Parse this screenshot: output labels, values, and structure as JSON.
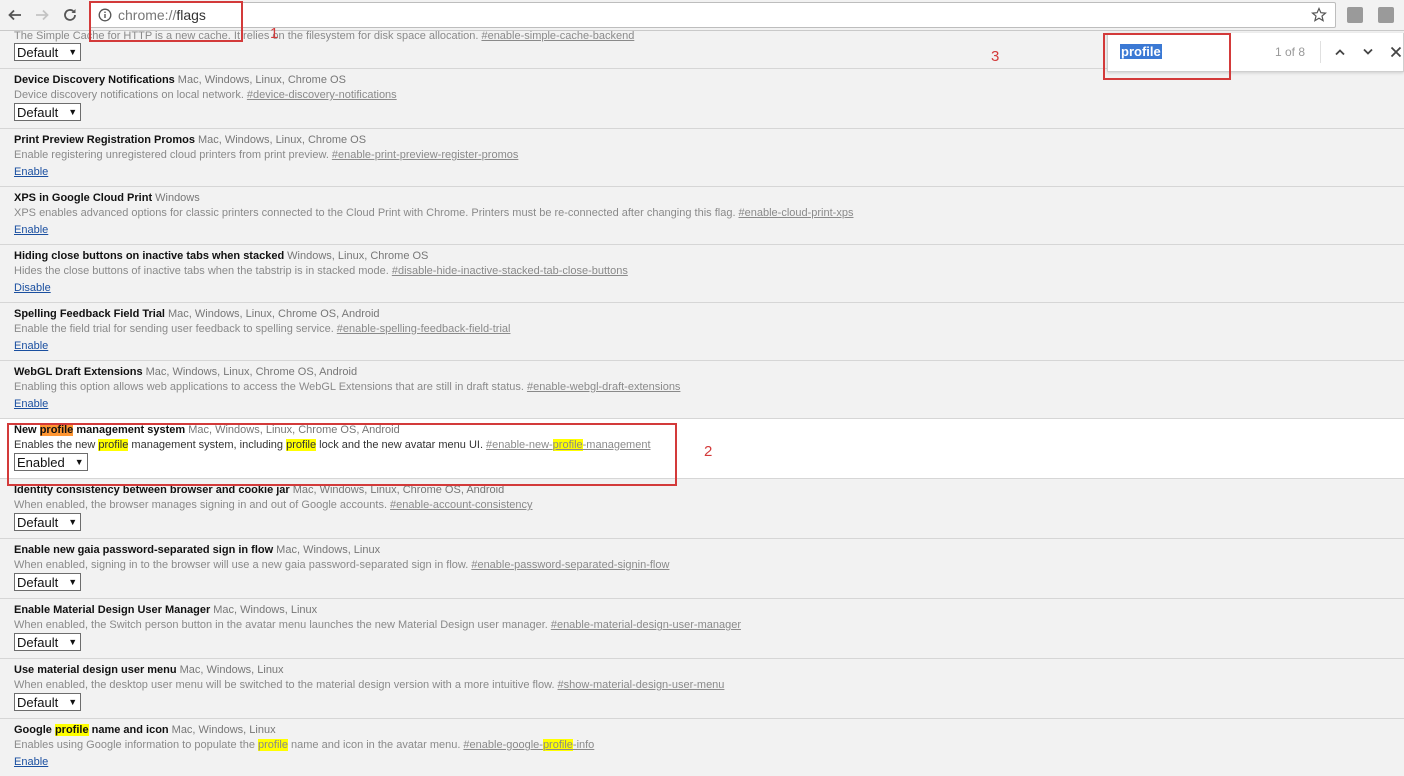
{
  "toolbar": {
    "url_scheme": "chrome://",
    "url_path": "flags",
    "icons": [
      "back-icon",
      "forward-icon",
      "reload-icon",
      "info-icon",
      "star-icon",
      "extension-icon"
    ]
  },
  "find": {
    "query": "profile",
    "count": "1 of 8",
    "icons": [
      "chevron-up-icon",
      "chevron-down-icon",
      "close-icon"
    ]
  },
  "annotations": {
    "n1": "1",
    "n2": "2",
    "n3": "3"
  },
  "colors": {
    "highlight": "#ffff00",
    "active_highlight": "#ff9632",
    "annotation": "#d33a3a",
    "link": "#1a4fa0"
  },
  "rows": [
    {
      "desc": "The Simple Cache for HTTP is a new cache. It relies on the filesystem for disk space allocation.",
      "anchor": "#enable-simple-cache-backend",
      "control": "Default"
    },
    {
      "title": "Device Discovery Notifications",
      "platforms": "Mac, Windows, Linux, Chrome OS",
      "desc": "Device discovery notifications on local network.",
      "anchor": "#device-discovery-notifications",
      "control": "Default"
    },
    {
      "title": "Print Preview Registration Promos",
      "platforms": "Mac, Windows, Linux, Chrome OS",
      "desc": "Enable registering unregistered cloud printers from print preview.",
      "anchor": "#enable-print-preview-register-promos",
      "link": "Enable"
    },
    {
      "title": "XPS in Google Cloud Print",
      "platforms": "Windows",
      "desc": "XPS enables advanced options for classic printers connected to the Cloud Print with Chrome. Printers must be re-connected after changing this flag.",
      "anchor": "#enable-cloud-print-xps",
      "link": "Enable"
    },
    {
      "title": "Hiding close buttons on inactive tabs when stacked",
      "platforms": "Windows, Linux, Chrome OS",
      "desc": "Hides the close buttons of inactive tabs when the tabstrip is in stacked mode.",
      "anchor": "#disable-hide-inactive-stacked-tab-close-buttons",
      "link": "Disable"
    },
    {
      "title": "Spelling Feedback Field Trial",
      "platforms": "Mac, Windows, Linux, Chrome OS, Android",
      "desc": "Enable the field trial for sending user feedback to spelling service.",
      "anchor": "#enable-spelling-feedback-field-trial",
      "link": "Enable"
    },
    {
      "title": "WebGL Draft Extensions",
      "platforms": "Mac, Windows, Linux, Chrome OS, Android",
      "desc": "Enabling this option allows web applications to access the WebGL Extensions that are still in draft status.",
      "anchor": "#enable-webgl-draft-extensions",
      "link": "Enable"
    },
    {
      "title_a": "New ",
      "title_hl": "profile",
      "title_b": " management system",
      "platforms": "Mac, Windows, Linux, Chrome OS, Android",
      "desc_a": "Enables the new ",
      "desc_hl1": "profile",
      "desc_b": " management system, including ",
      "desc_hl2": "profile",
      "desc_c": " lock and the new avatar menu UI.",
      "anchor_a": "#enable-new-",
      "anchor_hl": "profile",
      "anchor_b": "-management",
      "control": "Enabled"
    },
    {
      "title": "Identity consistency between browser and cookie jar",
      "platforms": "Mac, Windows, Linux, Chrome OS, Android",
      "desc": "When enabled, the browser manages signing in and out of Google accounts.",
      "anchor": "#enable-account-consistency",
      "control": "Default"
    },
    {
      "title": "Enable new gaia password-separated sign in flow",
      "platforms": "Mac, Windows, Linux",
      "desc": "When enabled, signing in to the browser will use a new gaia password-separated sign in flow.",
      "anchor": "#enable-password-separated-signin-flow",
      "control": "Default"
    },
    {
      "title": "Enable Material Design User Manager",
      "platforms": "Mac, Windows, Linux",
      "desc": "When enabled, the Switch person button in the avatar menu launches the new Material Design user manager.",
      "anchor": "#enable-material-design-user-manager",
      "control": "Default"
    },
    {
      "title": "Use material design user menu",
      "platforms": "Mac, Windows, Linux",
      "desc": "When enabled, the desktop user menu will be switched to the material design version with a more intuitive flow.",
      "anchor": "#show-material-design-user-menu",
      "control": "Default"
    },
    {
      "title_a": "Google ",
      "title_hl": "profile",
      "title_b": " name and icon",
      "platforms": "Mac, Windows, Linux",
      "desc_a": "Enables using Google information to populate the ",
      "desc_hl1": "profile",
      "desc_b": " name and icon in the avatar menu.",
      "anchor_a": "#enable-google-",
      "anchor_hl": "profile",
      "anchor_b": "-info",
      "link": "Enable"
    }
  ]
}
